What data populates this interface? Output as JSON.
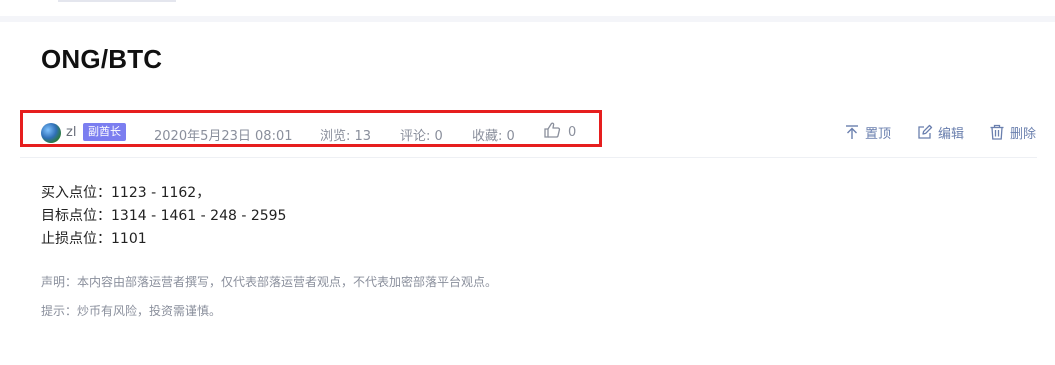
{
  "post": {
    "title": "ONG/BTC",
    "author": "zl",
    "badge": "副酋长",
    "datetime": "2020年5月23日 08:01",
    "views": "浏览: 13",
    "comments": "评论: 0",
    "favorites": "收藏: 0",
    "likes": "0"
  },
  "actions": {
    "pin": "置顶",
    "edit": "编辑",
    "delete": "删除"
  },
  "content": {
    "lines": [
      "买入点位：1123 - 1162，",
      "目标点位：1314 - 1461 - 248 - 2595",
      "止损点位：1101"
    ],
    "disclaimer": "声明：本内容由部落运营者撰写，仅代表部落运营者观点，不代表加密部落平台观点。",
    "tip": "提示：炒币有风险，投资需谨慎。"
  },
  "colors": {
    "highlight_border": "#e61e1e",
    "badge_bg": "#7b7ef0",
    "action_color": "#6a7fae",
    "meta_color": "#8a8f9c"
  },
  "icons": {
    "like": "thumbs-up-icon",
    "pin": "pin-top-icon",
    "edit": "edit-icon",
    "delete": "trash-icon"
  }
}
